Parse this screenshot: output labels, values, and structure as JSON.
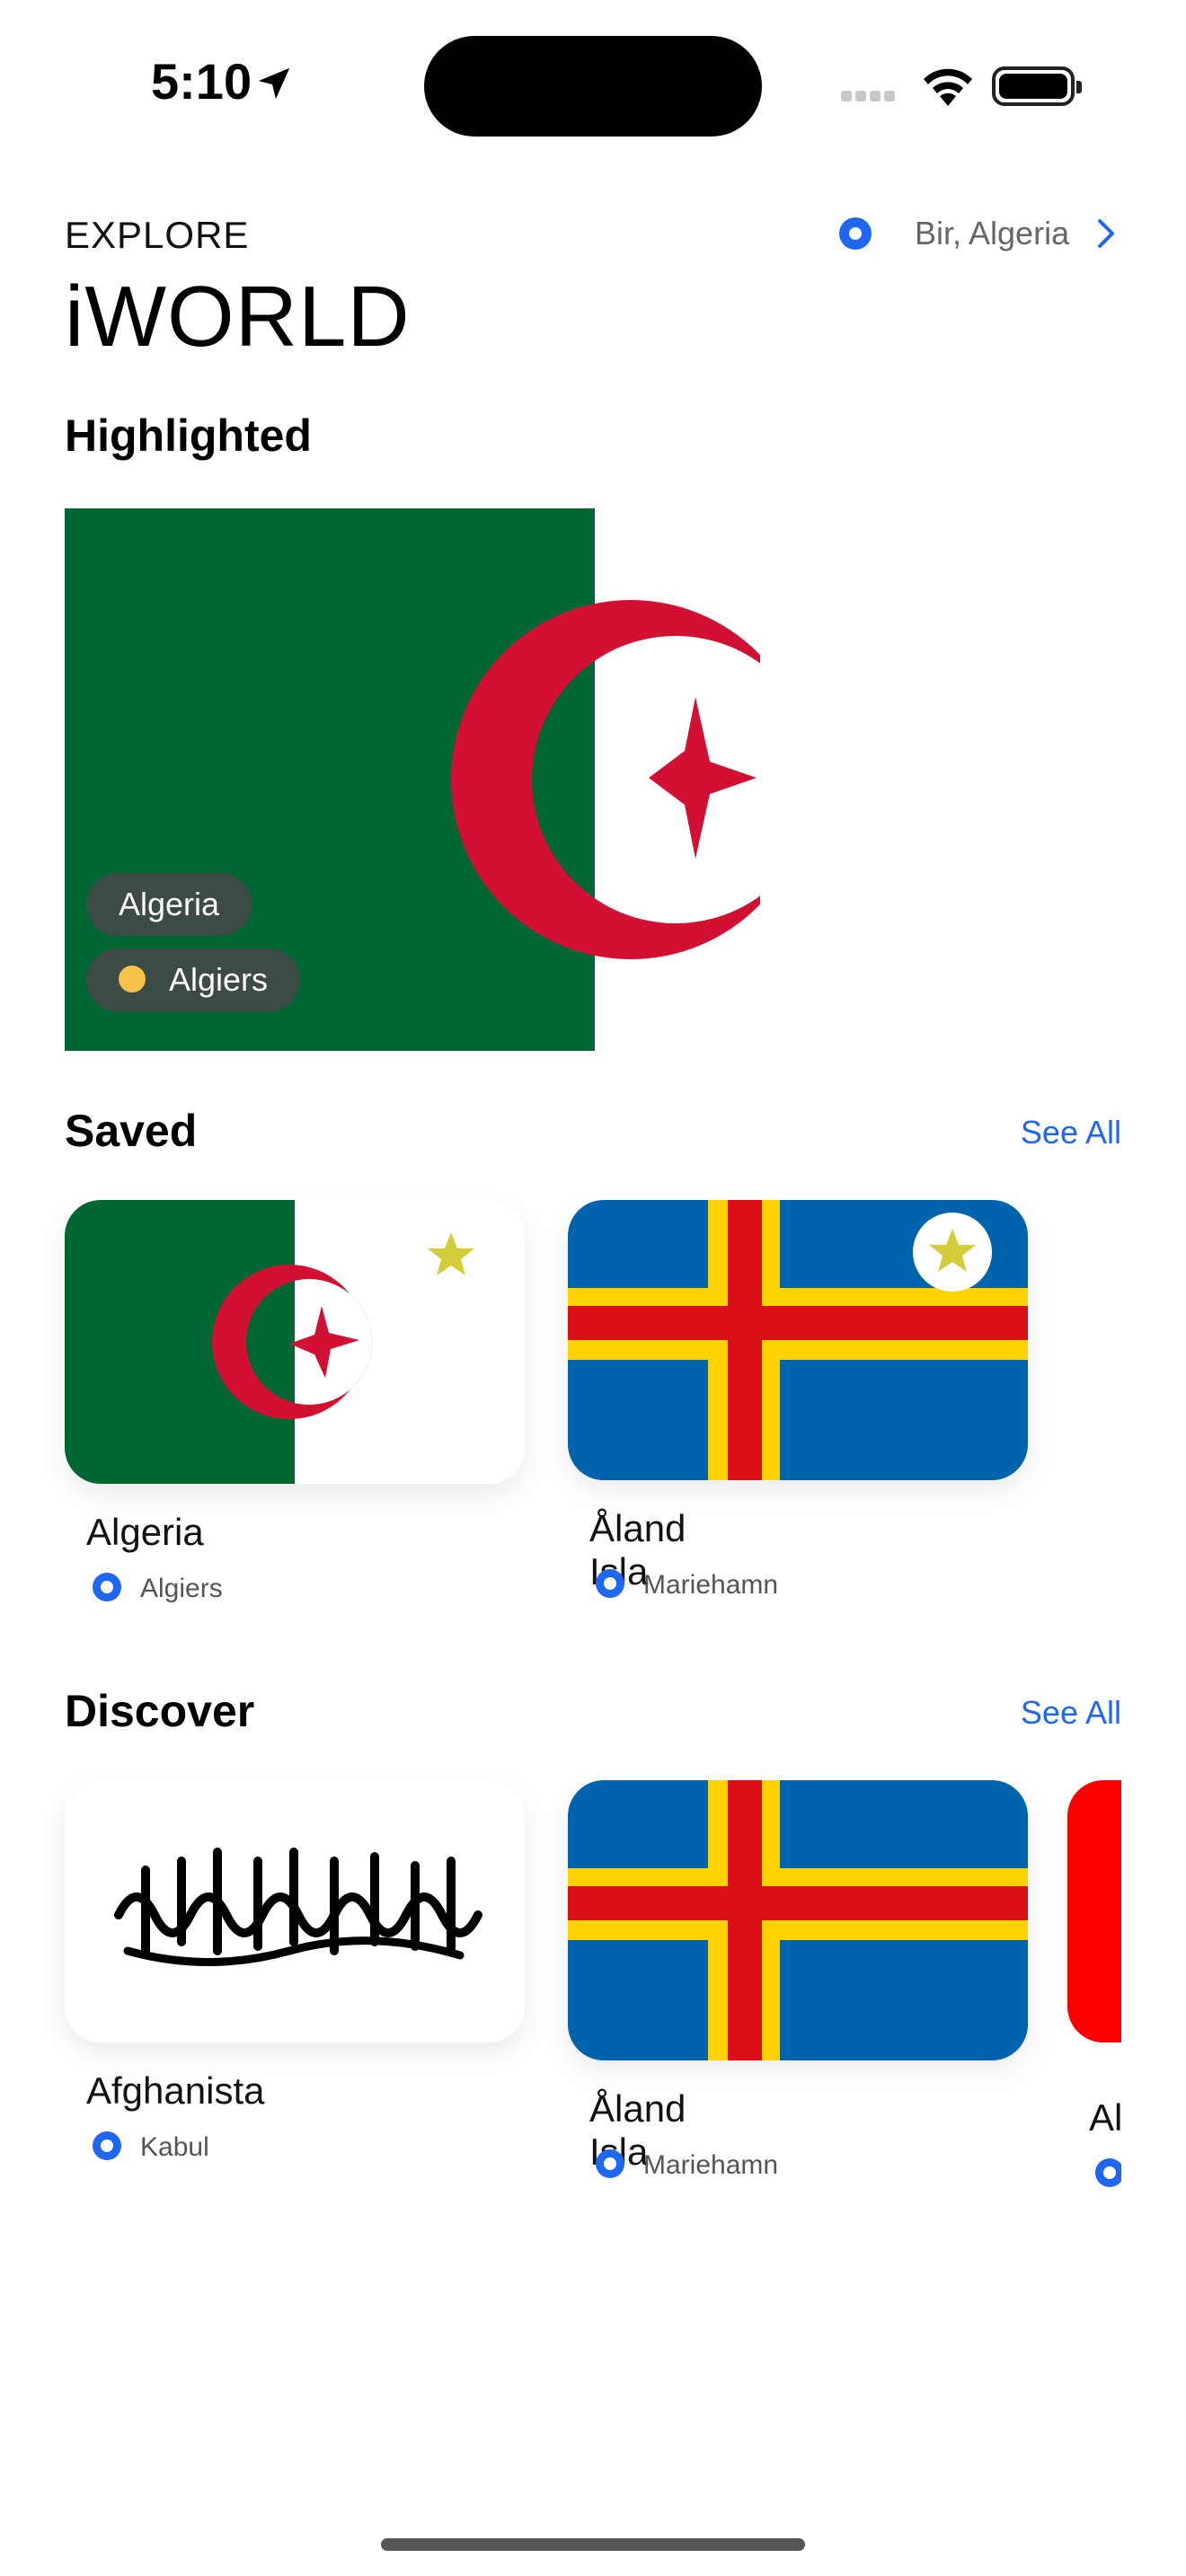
{
  "status_bar": {
    "time": "5:10"
  },
  "header": {
    "eyebrow": "EXPLORE",
    "title": "iWORLD",
    "location": "Bir, Algeria"
  },
  "highlighted": {
    "section_title": "Highlighted",
    "country": "Algeria",
    "capital": "Algiers"
  },
  "saved": {
    "section_title": "Saved",
    "see_all": "See All",
    "items": [
      {
        "country": "Algeria",
        "capital": "Algiers",
        "flag": "algeria-flag",
        "starred": true
      },
      {
        "country": "Åland Isla",
        "capital": "Mariehamn",
        "flag": "aland-flag",
        "starred": true
      }
    ]
  },
  "discover": {
    "section_title": "Discover",
    "see_all": "See All",
    "items": [
      {
        "country": "Afghanista",
        "capital": "Kabul",
        "flag": "afghanistan-flag"
      },
      {
        "country": "Åland Isla",
        "capital": "Mariehamn",
        "flag": "aland-flag"
      },
      {
        "country": "Al",
        "capital": "",
        "flag": "red-flag"
      }
    ]
  },
  "colors": {
    "accent": "#1f66f0",
    "algeria_green": "#006633",
    "algeria_red": "#d21034",
    "aland_blue": "#0064ad",
    "aland_yellow": "#ffd300",
    "aland_red": "#da0e15",
    "star": "#d4cd3a"
  }
}
